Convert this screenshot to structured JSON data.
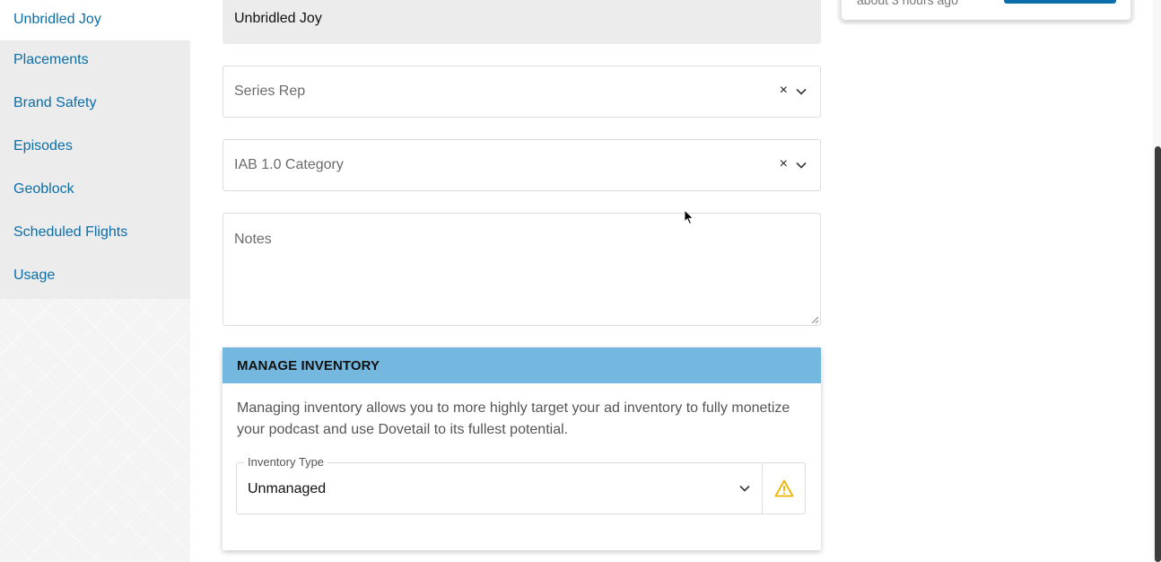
{
  "sidebar": {
    "items": [
      {
        "label": "Unbridled Joy",
        "active": true
      },
      {
        "label": "Placements"
      },
      {
        "label": "Brand Safety"
      },
      {
        "label": "Episodes"
      },
      {
        "label": "Geoblock"
      },
      {
        "label": "Scheduled Flights"
      },
      {
        "label": "Usage"
      }
    ]
  },
  "form": {
    "title_value": "Unbridled Joy",
    "series_rep": {
      "placeholder": "Series Rep",
      "clear": "×"
    },
    "iab_category": {
      "placeholder": "IAB 1.0 Category",
      "clear": "×"
    },
    "notes": {
      "placeholder": "Notes"
    }
  },
  "inventory": {
    "heading": "MANAGE INVENTORY",
    "description": "Managing inventory allows you to more highly target your ad inventory to fully monetize your podcast and use Dovetail to its fullest potential.",
    "type_label": "Inventory Type",
    "type_value": "Unmanaged",
    "warning_icon": "warning-triangle-icon",
    "warning_color": "#f0b400"
  },
  "right_panel": {
    "timestamp": "about 3 hours ago"
  },
  "colors": {
    "link": "#0a6fa8",
    "header_bg": "#74b8e0"
  }
}
